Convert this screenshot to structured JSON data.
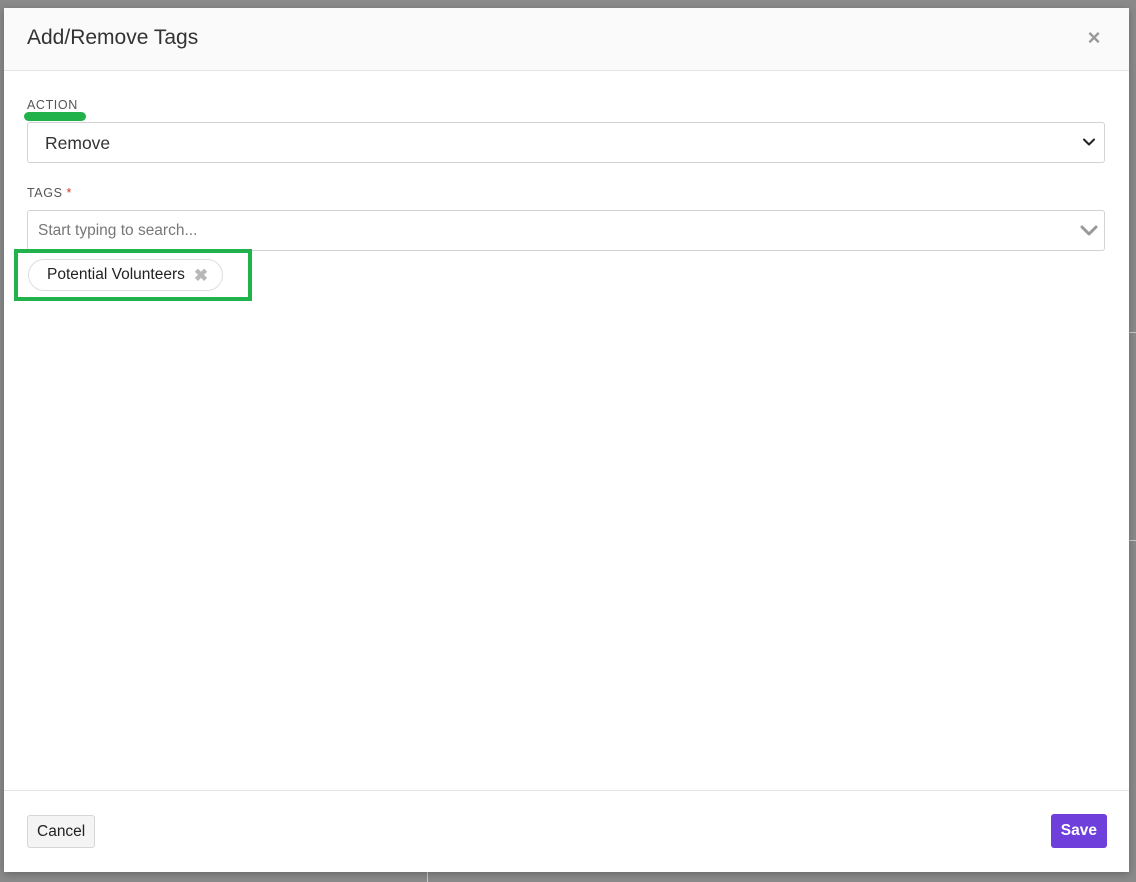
{
  "modal": {
    "title": "Add/Remove Tags",
    "close_symbol": "×"
  },
  "action_field": {
    "label": "ACTION",
    "value": "Remove",
    "options": [
      "Remove"
    ]
  },
  "tags_field": {
    "label": "TAGS",
    "required_mark": "*",
    "placeholder": "Start typing to search...",
    "selected_tags": [
      {
        "label": "Potential Volunteers",
        "remove_symbol": "✖"
      }
    ]
  },
  "footer": {
    "cancel_label": "Cancel",
    "save_label": "Save"
  },
  "icons": {
    "close": "close-icon",
    "select_chevron": "chevron-down-icon",
    "search_chevron": "chevron-down-icon",
    "tag_remove": "x-icon"
  },
  "colors": {
    "accent": "#6f3fdb",
    "highlight": "#22b24c",
    "required": "#d9322b"
  }
}
